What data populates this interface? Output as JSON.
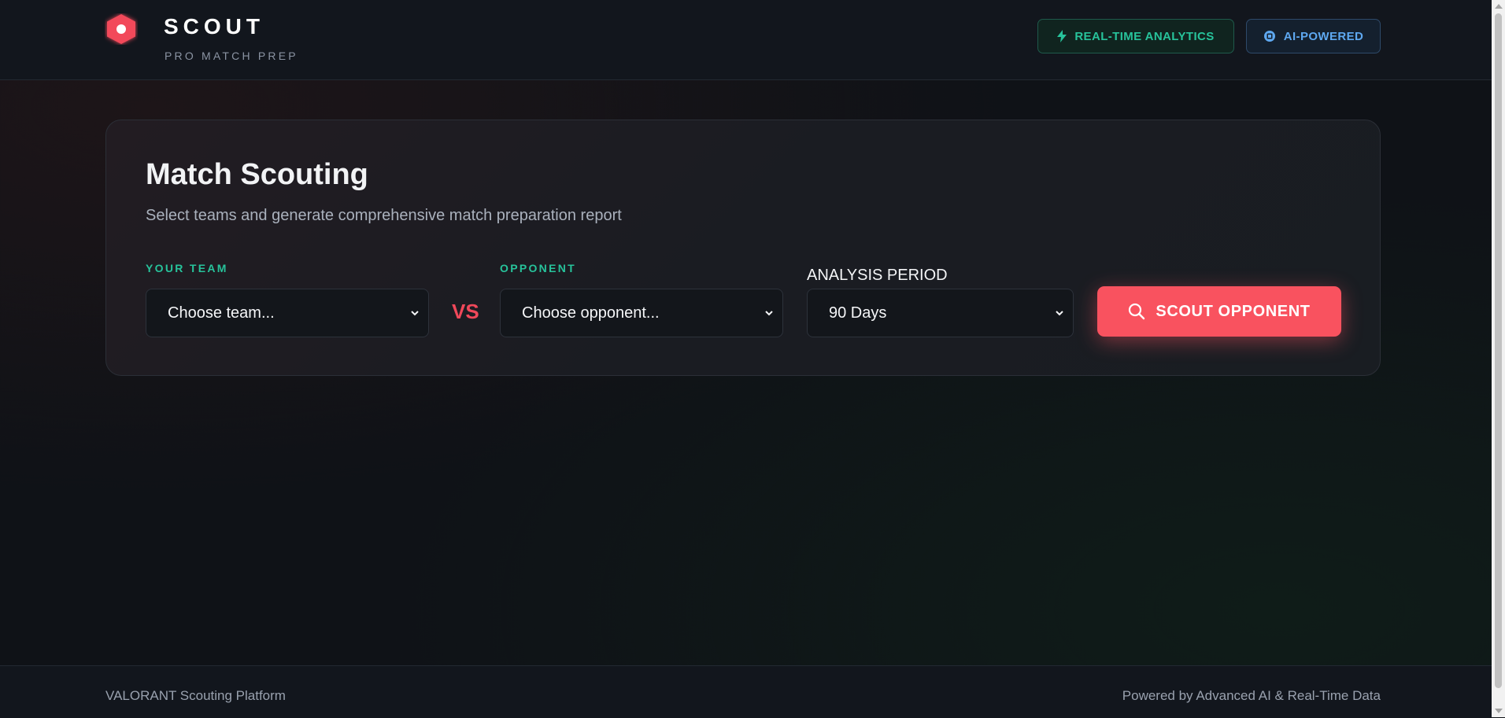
{
  "header": {
    "brand_title": "SCOUT",
    "brand_subtitle": "PRO MATCH PREP",
    "logo_icon": "hexagon-logo-icon",
    "badges": [
      {
        "label": "REAL-TIME ANALYTICS",
        "icon": "lightning-icon",
        "color": "#27c39b"
      },
      {
        "label": "AI-POWERED",
        "icon": "chip-icon",
        "color": "#5ea8f0"
      }
    ]
  },
  "card": {
    "title": "Match Scouting",
    "subtitle": "Select teams and generate comprehensive match preparation report",
    "your_team": {
      "label": "YOUR TEAM",
      "value": "Choose team..."
    },
    "vs_text": "VS",
    "opponent": {
      "label": "OPPONENT",
      "value": "Choose opponent..."
    },
    "analysis_period": {
      "label": "ANALYSIS PERIOD",
      "value": "90 Days"
    },
    "scout_button": {
      "label": "SCOUT OPPONENT",
      "icon": "search-icon"
    }
  },
  "footer": {
    "left_text": "VALORANT Scouting Platform",
    "right_text": "Powered by Advanced AI & Real-Time Data"
  },
  "colors": {
    "accent_red": "#f9525f",
    "accent_green": "#27c39b",
    "accent_blue": "#5ea8f0",
    "background": "#0f1217"
  }
}
